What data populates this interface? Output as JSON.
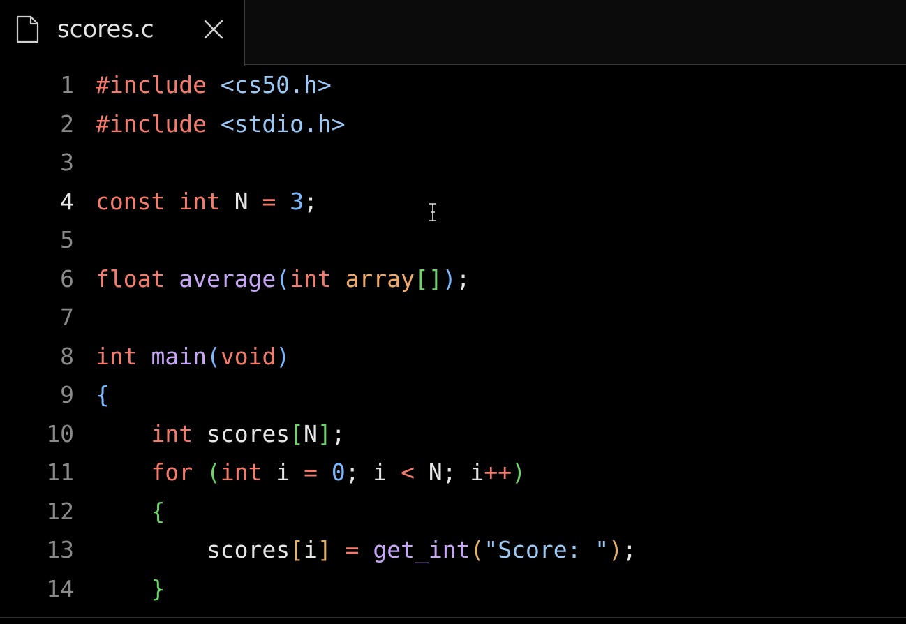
{
  "tab": {
    "title": "scores.c",
    "file_icon": "file-icon",
    "close_icon": "close-icon"
  },
  "colors": {
    "background": "#000000",
    "tab_text": "#e6e6e6",
    "line_number": "#8a8a8a",
    "line_number_active": "#e6e6e6",
    "keyword": "#f47a6b",
    "function": "#c8a6f7",
    "string_blue": "#9cc8f5",
    "number": "#79b8ff",
    "operator": "#f47a6b",
    "param": "#f0a96b",
    "bracket_green": "#6ed36b",
    "bracket_blue": "#79b8ff",
    "bracket_orange": "#e3b16b",
    "plain": "#e6e6e6"
  },
  "editor": {
    "active_line": 4,
    "lines": [
      {
        "n": "1",
        "tokens": [
          {
            "t": "#include",
            "c": "keyword"
          },
          {
            "t": " ",
            "c": "plain"
          },
          {
            "t": "<cs50.h>",
            "c": "string_blue"
          }
        ]
      },
      {
        "n": "2",
        "tokens": [
          {
            "t": "#include",
            "c": "keyword"
          },
          {
            "t": " ",
            "c": "plain"
          },
          {
            "t": "<stdio.h>",
            "c": "string_blue"
          }
        ]
      },
      {
        "n": "3",
        "tokens": []
      },
      {
        "n": "4",
        "tokens": [
          {
            "t": "const",
            "c": "keyword"
          },
          {
            "t": " ",
            "c": "plain"
          },
          {
            "t": "int",
            "c": "keyword"
          },
          {
            "t": " N ",
            "c": "plain"
          },
          {
            "t": "=",
            "c": "operator"
          },
          {
            "t": " ",
            "c": "plain"
          },
          {
            "t": "3",
            "c": "number"
          },
          {
            "t": ";",
            "c": "plain"
          }
        ]
      },
      {
        "n": "5",
        "tokens": []
      },
      {
        "n": "6",
        "tokens": [
          {
            "t": "float",
            "c": "keyword"
          },
          {
            "t": " ",
            "c": "plain"
          },
          {
            "t": "average",
            "c": "function"
          },
          {
            "t": "(",
            "c": "bracket_blue"
          },
          {
            "t": "int",
            "c": "keyword"
          },
          {
            "t": " ",
            "c": "plain"
          },
          {
            "t": "array",
            "c": "param"
          },
          {
            "t": "[]",
            "c": "bracket_green"
          },
          {
            "t": ")",
            "c": "bracket_blue"
          },
          {
            "t": ";",
            "c": "plain"
          }
        ]
      },
      {
        "n": "7",
        "tokens": []
      },
      {
        "n": "8",
        "tokens": [
          {
            "t": "int",
            "c": "keyword"
          },
          {
            "t": " ",
            "c": "plain"
          },
          {
            "t": "main",
            "c": "function"
          },
          {
            "t": "(",
            "c": "bracket_blue"
          },
          {
            "t": "void",
            "c": "keyword"
          },
          {
            "t": ")",
            "c": "bracket_blue"
          }
        ]
      },
      {
        "n": "9",
        "tokens": [
          {
            "t": "{",
            "c": "bracket_blue"
          }
        ]
      },
      {
        "n": "10",
        "tokens": [
          {
            "t": "    ",
            "c": "plain"
          },
          {
            "t": "int",
            "c": "keyword"
          },
          {
            "t": " scores",
            "c": "plain"
          },
          {
            "t": "[",
            "c": "bracket_green"
          },
          {
            "t": "N",
            "c": "plain"
          },
          {
            "t": "]",
            "c": "bracket_green"
          },
          {
            "t": ";",
            "c": "plain"
          }
        ]
      },
      {
        "n": "11",
        "tokens": [
          {
            "t": "    ",
            "c": "plain"
          },
          {
            "t": "for",
            "c": "keyword"
          },
          {
            "t": " ",
            "c": "plain"
          },
          {
            "t": "(",
            "c": "bracket_green"
          },
          {
            "t": "int",
            "c": "keyword"
          },
          {
            "t": " i ",
            "c": "plain"
          },
          {
            "t": "=",
            "c": "operator"
          },
          {
            "t": " ",
            "c": "plain"
          },
          {
            "t": "0",
            "c": "number"
          },
          {
            "t": "; i ",
            "c": "plain"
          },
          {
            "t": "<",
            "c": "operator"
          },
          {
            "t": " N; i",
            "c": "plain"
          },
          {
            "t": "++",
            "c": "operator"
          },
          {
            "t": ")",
            "c": "bracket_green"
          }
        ]
      },
      {
        "n": "12",
        "tokens": [
          {
            "t": "    ",
            "c": "plain"
          },
          {
            "t": "{",
            "c": "bracket_green"
          }
        ]
      },
      {
        "n": "13",
        "tokens": [
          {
            "t": "        scores",
            "c": "plain"
          },
          {
            "t": "[",
            "c": "bracket_orange"
          },
          {
            "t": "i",
            "c": "plain"
          },
          {
            "t": "]",
            "c": "bracket_orange"
          },
          {
            "t": " ",
            "c": "plain"
          },
          {
            "t": "=",
            "c": "operator"
          },
          {
            "t": " ",
            "c": "plain"
          },
          {
            "t": "get_int",
            "c": "function"
          },
          {
            "t": "(",
            "c": "bracket_orange"
          },
          {
            "t": "\"Score: \"",
            "c": "string_blue"
          },
          {
            "t": ")",
            "c": "bracket_orange"
          },
          {
            "t": ";",
            "c": "plain"
          }
        ]
      },
      {
        "n": "14",
        "tokens": [
          {
            "t": "    ",
            "c": "plain"
          },
          {
            "t": "}",
            "c": "bracket_green"
          }
        ]
      }
    ]
  }
}
